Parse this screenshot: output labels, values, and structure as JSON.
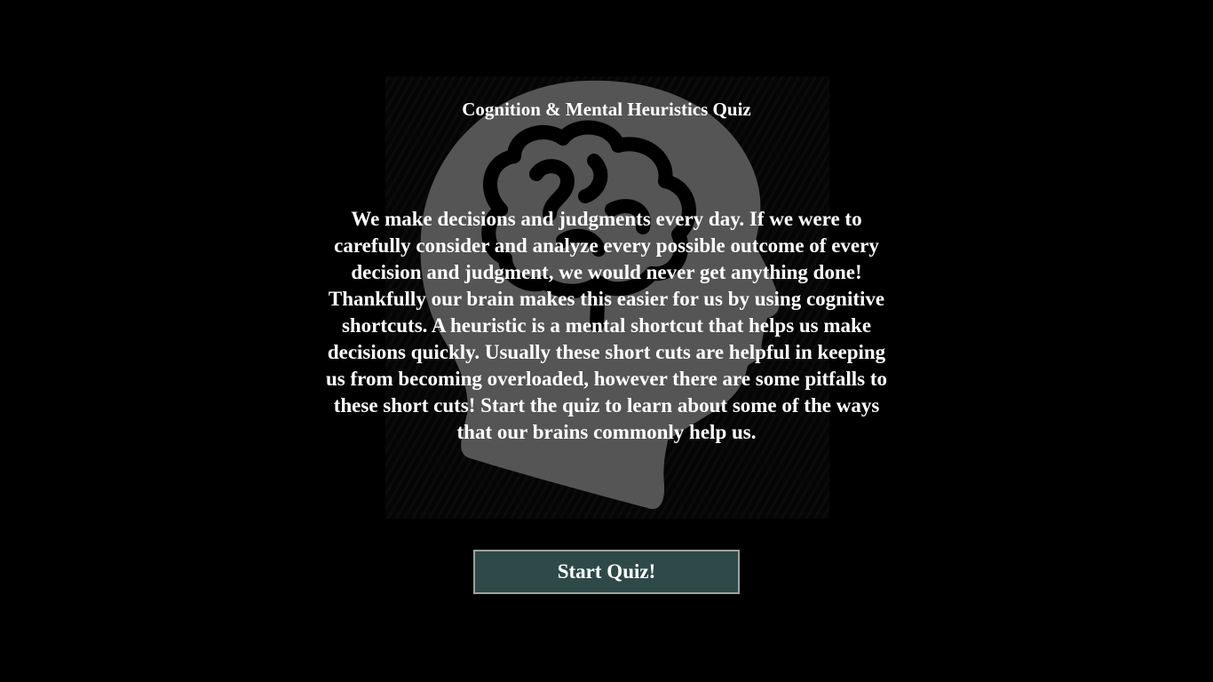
{
  "page": {
    "title": "Cognition & Mental Heuristics Quiz",
    "intro": "We make decisions and judgments every day. If we were to carefully consider and analyze every possible outcome of every decision and judgment, we would never get anything done! Thankfully our brain makes this easier for us by using cognitive shortcuts. A heuristic is a mental shortcut that helps us make decisions quickly. Usually these short cuts are helpful in keeping us from becoming overloaded, however there are some pitfalls to these short cuts! Start the quiz to learn about some of the ways that our brains commonly help us.",
    "start_button_label": "Start Quiz!"
  },
  "theme": {
    "background": "#000000",
    "illustration_color": "#555555",
    "button_fill": "#2e4a48",
    "button_border": "#9aa3a2",
    "text_color": "#ffffff"
  },
  "icons": {
    "illustration": "head-with-brain-icon"
  }
}
